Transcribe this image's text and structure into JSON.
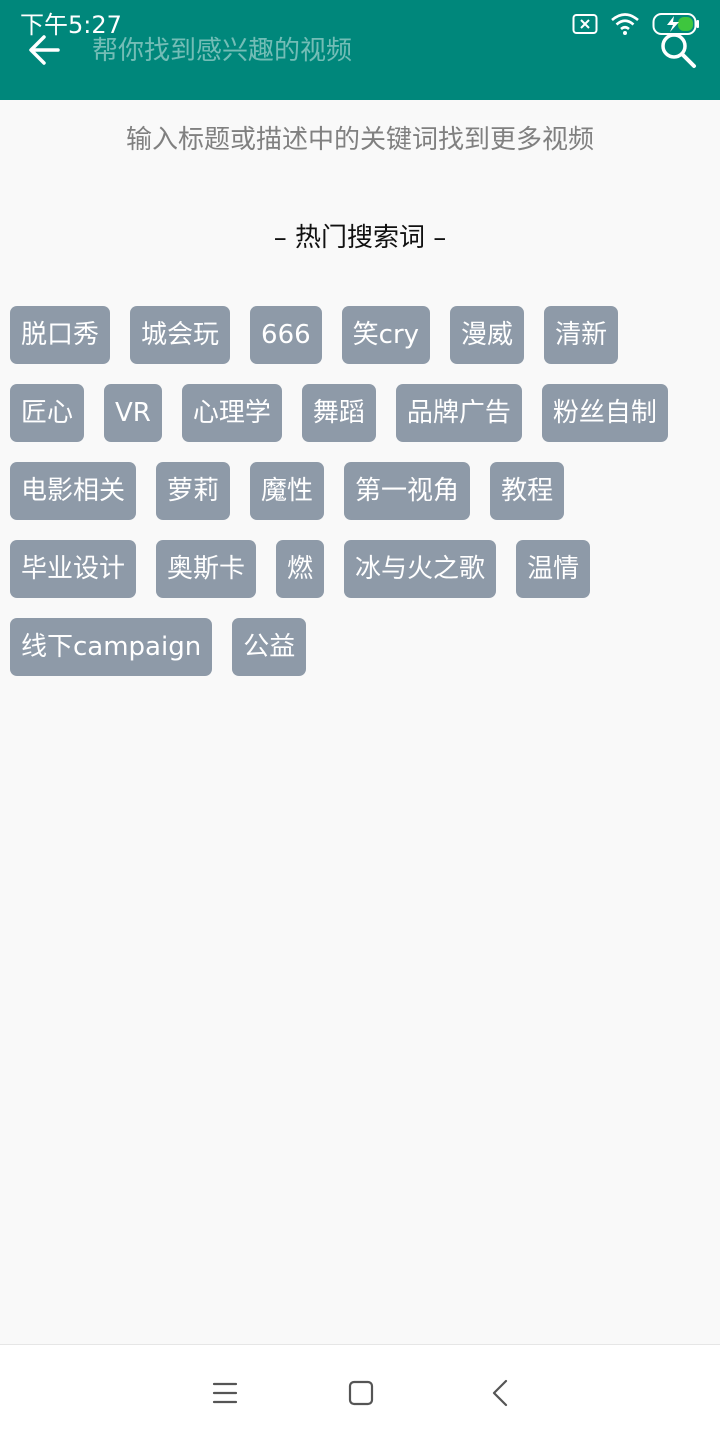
{
  "status_bar": {
    "time": "下午5:27"
  },
  "header": {
    "search_placeholder": "帮你找到感兴趣的视频",
    "back_icon": "arrow-left-icon",
    "search_icon": "search-icon",
    "background_color": "#00877b"
  },
  "hint": "输入标题或描述中的关键词找到更多视频",
  "hot_title": "– 热门搜索词 –",
  "tags": {
    "row1": [
      "脱口秀",
      "城会玩",
      "666",
      "笑cry",
      "漫威",
      "清新"
    ],
    "row2": [
      "匠心",
      "VR",
      "心理学",
      "舞蹈",
      "品牌广告",
      "粉丝自制"
    ],
    "row3": [
      "电影相关",
      "萝莉",
      "魔性",
      "第一视角",
      "教程"
    ],
    "row4": [
      "毕业设计",
      "奥斯卡",
      "燃",
      "冰与火之歌",
      "温情"
    ],
    "row5": [
      "线下campaign",
      "公益"
    ]
  },
  "tag_color": "#8e9aa8",
  "nav": {
    "menu_icon": "menu-icon",
    "home_icon": "home-square-icon",
    "back_icon": "back-chevron-icon"
  }
}
